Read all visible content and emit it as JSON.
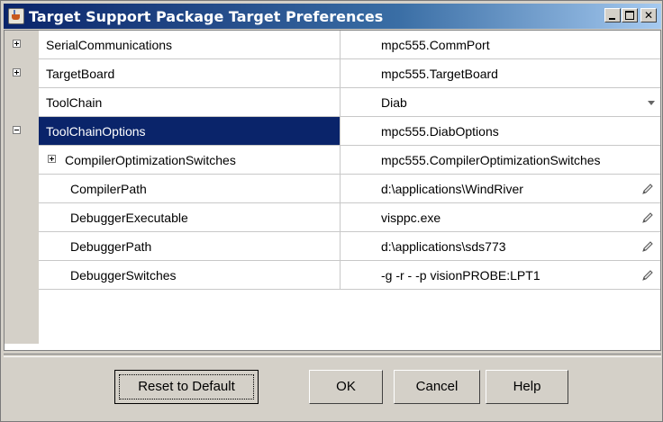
{
  "window": {
    "title": "Target Support Package Target Preferences",
    "controls": {
      "minimize": "_",
      "maximize": "□",
      "close": "✕"
    }
  },
  "properties": [
    {
      "name": "SerialCommunications",
      "value": "mpc555.CommPort",
      "expander": "plus",
      "level": 0
    },
    {
      "name": "TargetBoard",
      "value": "mpc555.TargetBoard",
      "expander": "plus",
      "level": 0
    },
    {
      "name": "ToolChain",
      "value": "Diab",
      "expander": "none",
      "level": 0,
      "editor": "dropdown"
    },
    {
      "name": "ToolChainOptions",
      "value": "mpc555.DiabOptions",
      "expander": "minus",
      "level": 0,
      "selected": true
    },
    {
      "name": "CompilerOptimizationSwitches",
      "value": "mpc555.CompilerOptimizationSwitches",
      "expander": "plus",
      "level": 1
    },
    {
      "name": "CompilerPath",
      "value": "d:\\applications\\WindRiver",
      "expander": "none",
      "level": 1,
      "editor": "pencil"
    },
    {
      "name": "DebuggerExecutable",
      "value": "visppc.exe",
      "expander": "none",
      "level": 1,
      "editor": "pencil"
    },
    {
      "name": "DebuggerPath",
      "value": "d:\\applications\\sds773",
      "expander": "none",
      "level": 1,
      "editor": "pencil"
    },
    {
      "name": "DebuggerSwitches",
      "value": "-g -r - -p visionPROBE:LPT1",
      "expander": "none",
      "level": 1,
      "editor": "pencil"
    }
  ],
  "buttons": {
    "reset": "Reset to Default",
    "ok": "OK",
    "cancel": "Cancel",
    "help": "Help"
  },
  "colors": {
    "selection": "#0a246a",
    "titlebar_start": "#0a246a",
    "titlebar_end": "#a6caf0",
    "face": "#d4d0c8"
  }
}
